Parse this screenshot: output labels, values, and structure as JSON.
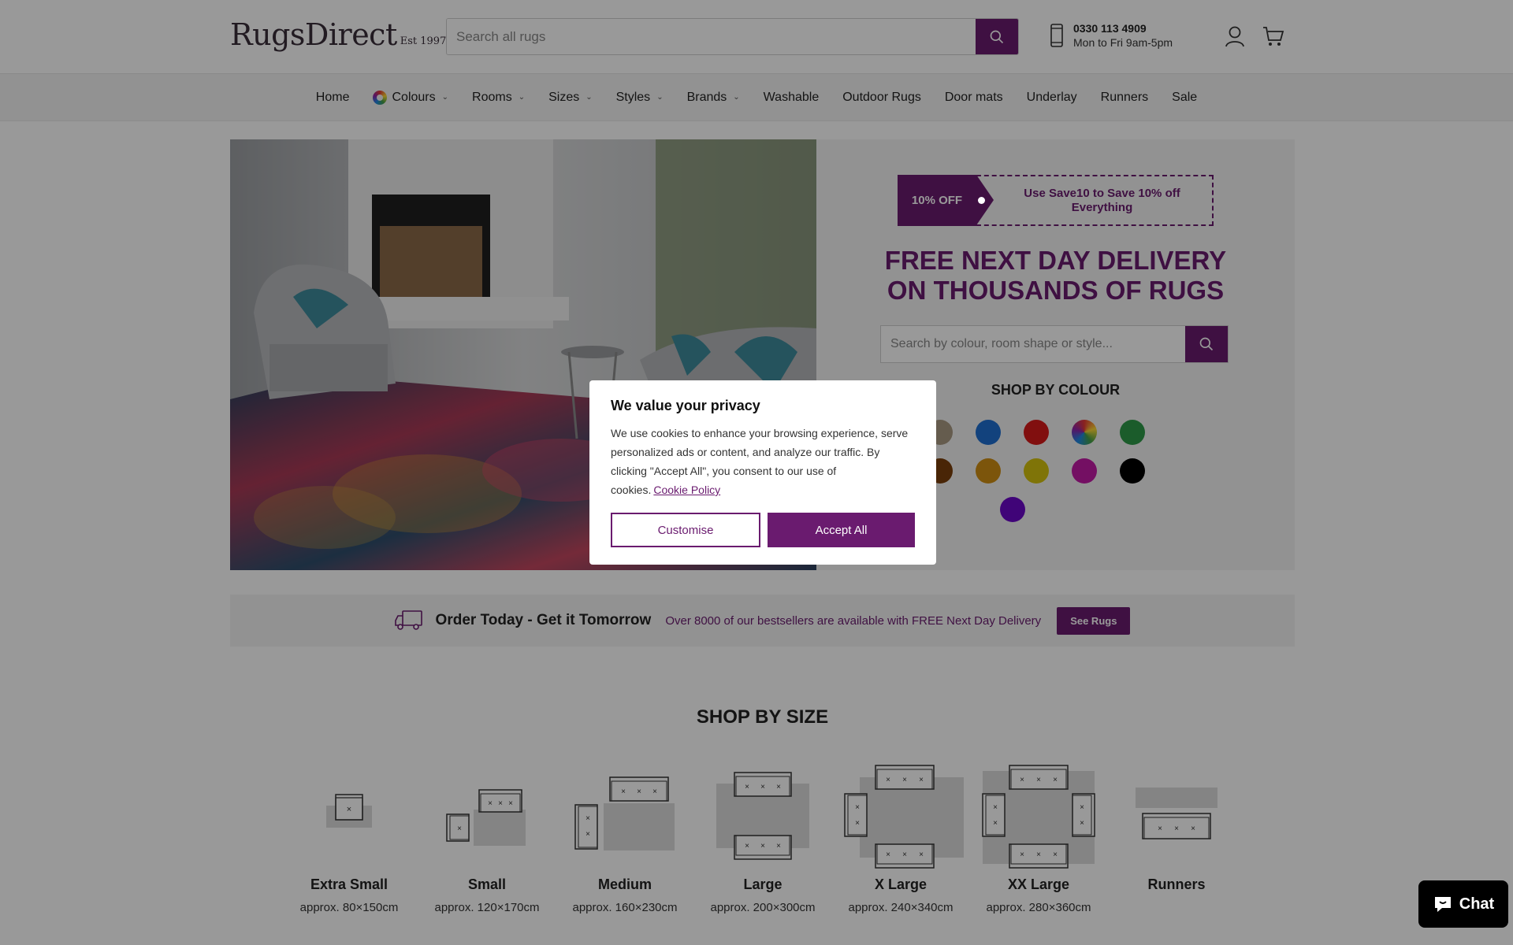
{
  "header": {
    "logo_main": "RugsDirect",
    "logo_est": "Est 1997",
    "search_placeholder": "Search all rugs",
    "phone_number": "0330 113 4909",
    "phone_hours": "Mon to Fri 9am-5pm"
  },
  "nav": {
    "items": [
      {
        "label": "Home",
        "dropdown": false
      },
      {
        "label": "Colours",
        "dropdown": true
      },
      {
        "label": "Rooms",
        "dropdown": true
      },
      {
        "label": "Sizes",
        "dropdown": true
      },
      {
        "label": "Styles",
        "dropdown": true
      },
      {
        "label": "Brands",
        "dropdown": true
      },
      {
        "label": "Washable",
        "dropdown": false
      },
      {
        "label": "Outdoor Rugs",
        "dropdown": false
      },
      {
        "label": "Door mats",
        "dropdown": false
      },
      {
        "label": "Underlay",
        "dropdown": false
      },
      {
        "label": "Runners",
        "dropdown": false
      },
      {
        "label": "Sale",
        "dropdown": false
      }
    ]
  },
  "hero": {
    "promo_tag": "10% OFF",
    "promo_text": "Use Save10 to Save 10% off Everything",
    "title_line1": "FREE NEXT DAY DELIVERY",
    "title_line2": "ON THOUSANDS OF RUGS",
    "search_placeholder": "Search by colour, room shape or style...",
    "shop_by_colour": "SHOP BY COLOUR",
    "swatch_colors": [
      "#9a9a9a",
      "#a89a82",
      "#1e6fd0",
      "#d71a1a",
      "rainbow",
      "#2e9a48",
      "#e8ddd0",
      "#7a3e0a",
      "#cf8e13",
      "#d4c20e",
      "#c21aa6",
      "#000000",
      "#6b08c9"
    ]
  },
  "delivery": {
    "title": "Order Today - Get it Tomorrow",
    "subtitle": "Over 8000 of our bestsellers are available with FREE Next Day Delivery",
    "button": "See Rugs"
  },
  "sizes": {
    "title": "SHOP BY SIZE",
    "items": [
      {
        "name": "Extra Small",
        "dim": "approx. 80×150cm"
      },
      {
        "name": "Small",
        "dim": "approx. 120×170cm"
      },
      {
        "name": "Medium",
        "dim": "approx. 160×230cm"
      },
      {
        "name": "Large",
        "dim": "approx. 200×300cm"
      },
      {
        "name": "X Large",
        "dim": "approx. 240×340cm"
      },
      {
        "name": "XX Large",
        "dim": "approx. 280×360cm"
      },
      {
        "name": "Runners",
        "dim": ""
      }
    ]
  },
  "cookie": {
    "title": "We value your privacy",
    "body": "We use cookies to enhance your browsing experience, serve personalized ads or content, and analyze our traffic. By clicking \"Accept All\", you consent to our use of cookies.",
    "link": "Cookie Policy",
    "customise": "Customise",
    "accept": "Accept All"
  },
  "chat": {
    "label": "Chat"
  },
  "colors": {
    "brand_purple": "#6a1b6f"
  }
}
